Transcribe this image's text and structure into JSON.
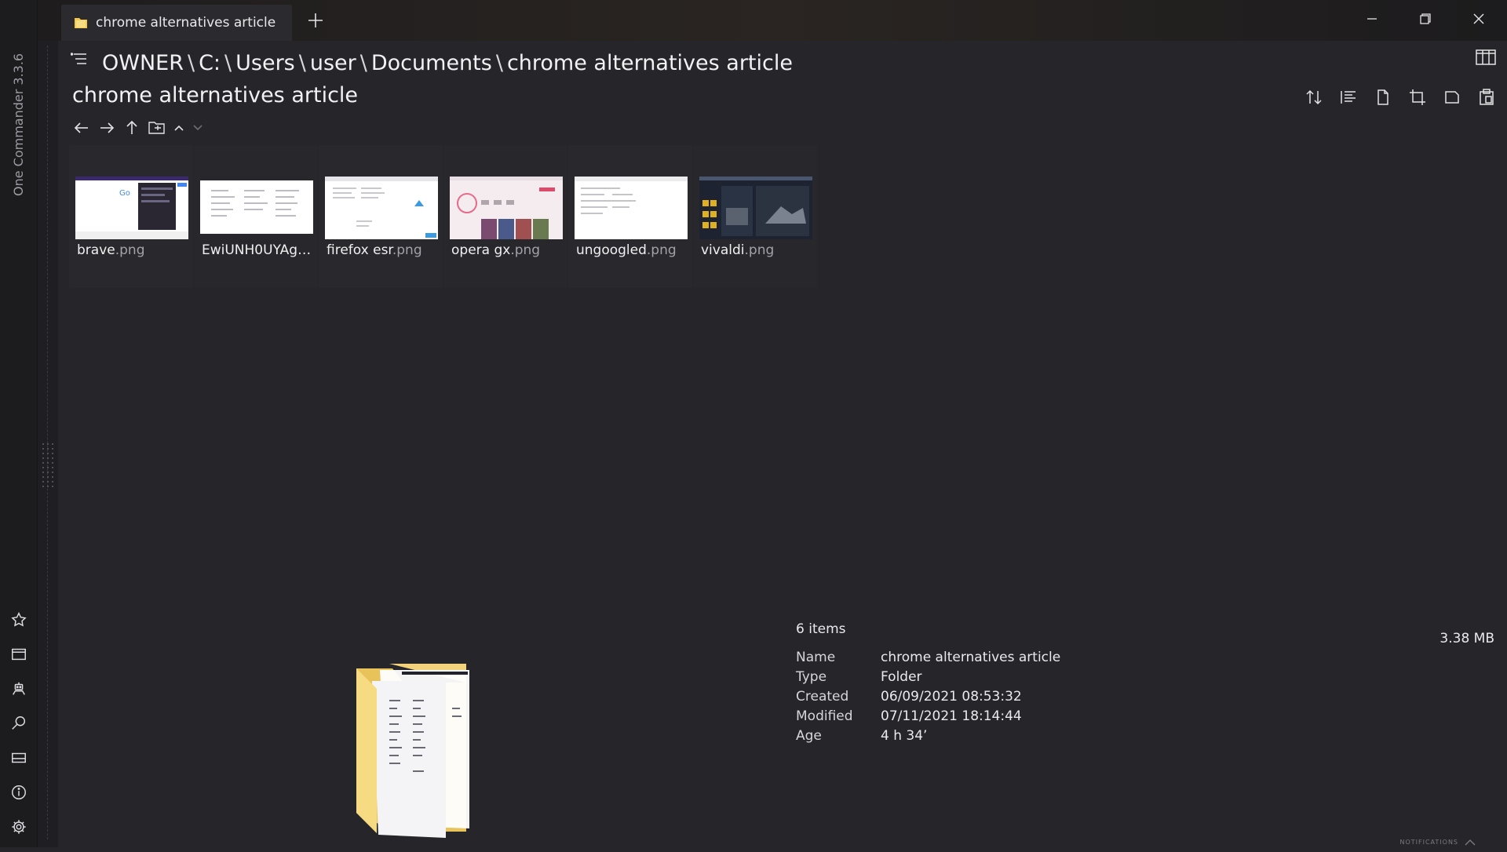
{
  "app": {
    "title": "One Commander 3.3.6"
  },
  "tab": {
    "label": "chrome alternatives article",
    "new_tab_label": "+"
  },
  "breadcrumb": {
    "segments": [
      "OWNER",
      "C:",
      "Users",
      "user",
      "Documents",
      "chrome alternatives article"
    ],
    "separator": "\\"
  },
  "folder": {
    "title": "chrome alternatives article"
  },
  "files": [
    {
      "base": "brave",
      "ext": ".png"
    },
    {
      "base": "EwiUNH0UYAgL...",
      "ext": ""
    },
    {
      "base": "firefox esr",
      "ext": ".png"
    },
    {
      "base": "opera gx",
      "ext": ".png"
    },
    {
      "base": "ungoogled",
      "ext": ".png"
    },
    {
      "base": "vivaldi",
      "ext": ".png"
    }
  ],
  "info": {
    "items_count": "6 items",
    "total_size": "3.38 MB",
    "properties": [
      {
        "key": "Name",
        "value": "chrome alternatives article"
      },
      {
        "key": "Type",
        "value": "Folder"
      },
      {
        "key": "Created",
        "value": "06/09/2021 08:53:32"
      },
      {
        "key": "Modified",
        "value": "07/11/2021 18:14:44"
      },
      {
        "key": "Age",
        "value": "4 h 34’"
      }
    ]
  },
  "footer": {
    "notifications_label": "NOTIFICATIONS"
  },
  "icons": {
    "rail": [
      "star-icon",
      "window-icon",
      "robot-icon",
      "search-icon",
      "panel-icon",
      "info-icon",
      "gear-icon"
    ],
    "toolbar": [
      "sort-icon",
      "list-icon",
      "new-file-icon",
      "crop-icon",
      "tablet-icon",
      "clipboard-icon"
    ]
  },
  "colors": {
    "background": "#262529",
    "rail": "#1c1b1e",
    "folder_yellow": "#f5d36b",
    "text": "#e9e9ec"
  }
}
